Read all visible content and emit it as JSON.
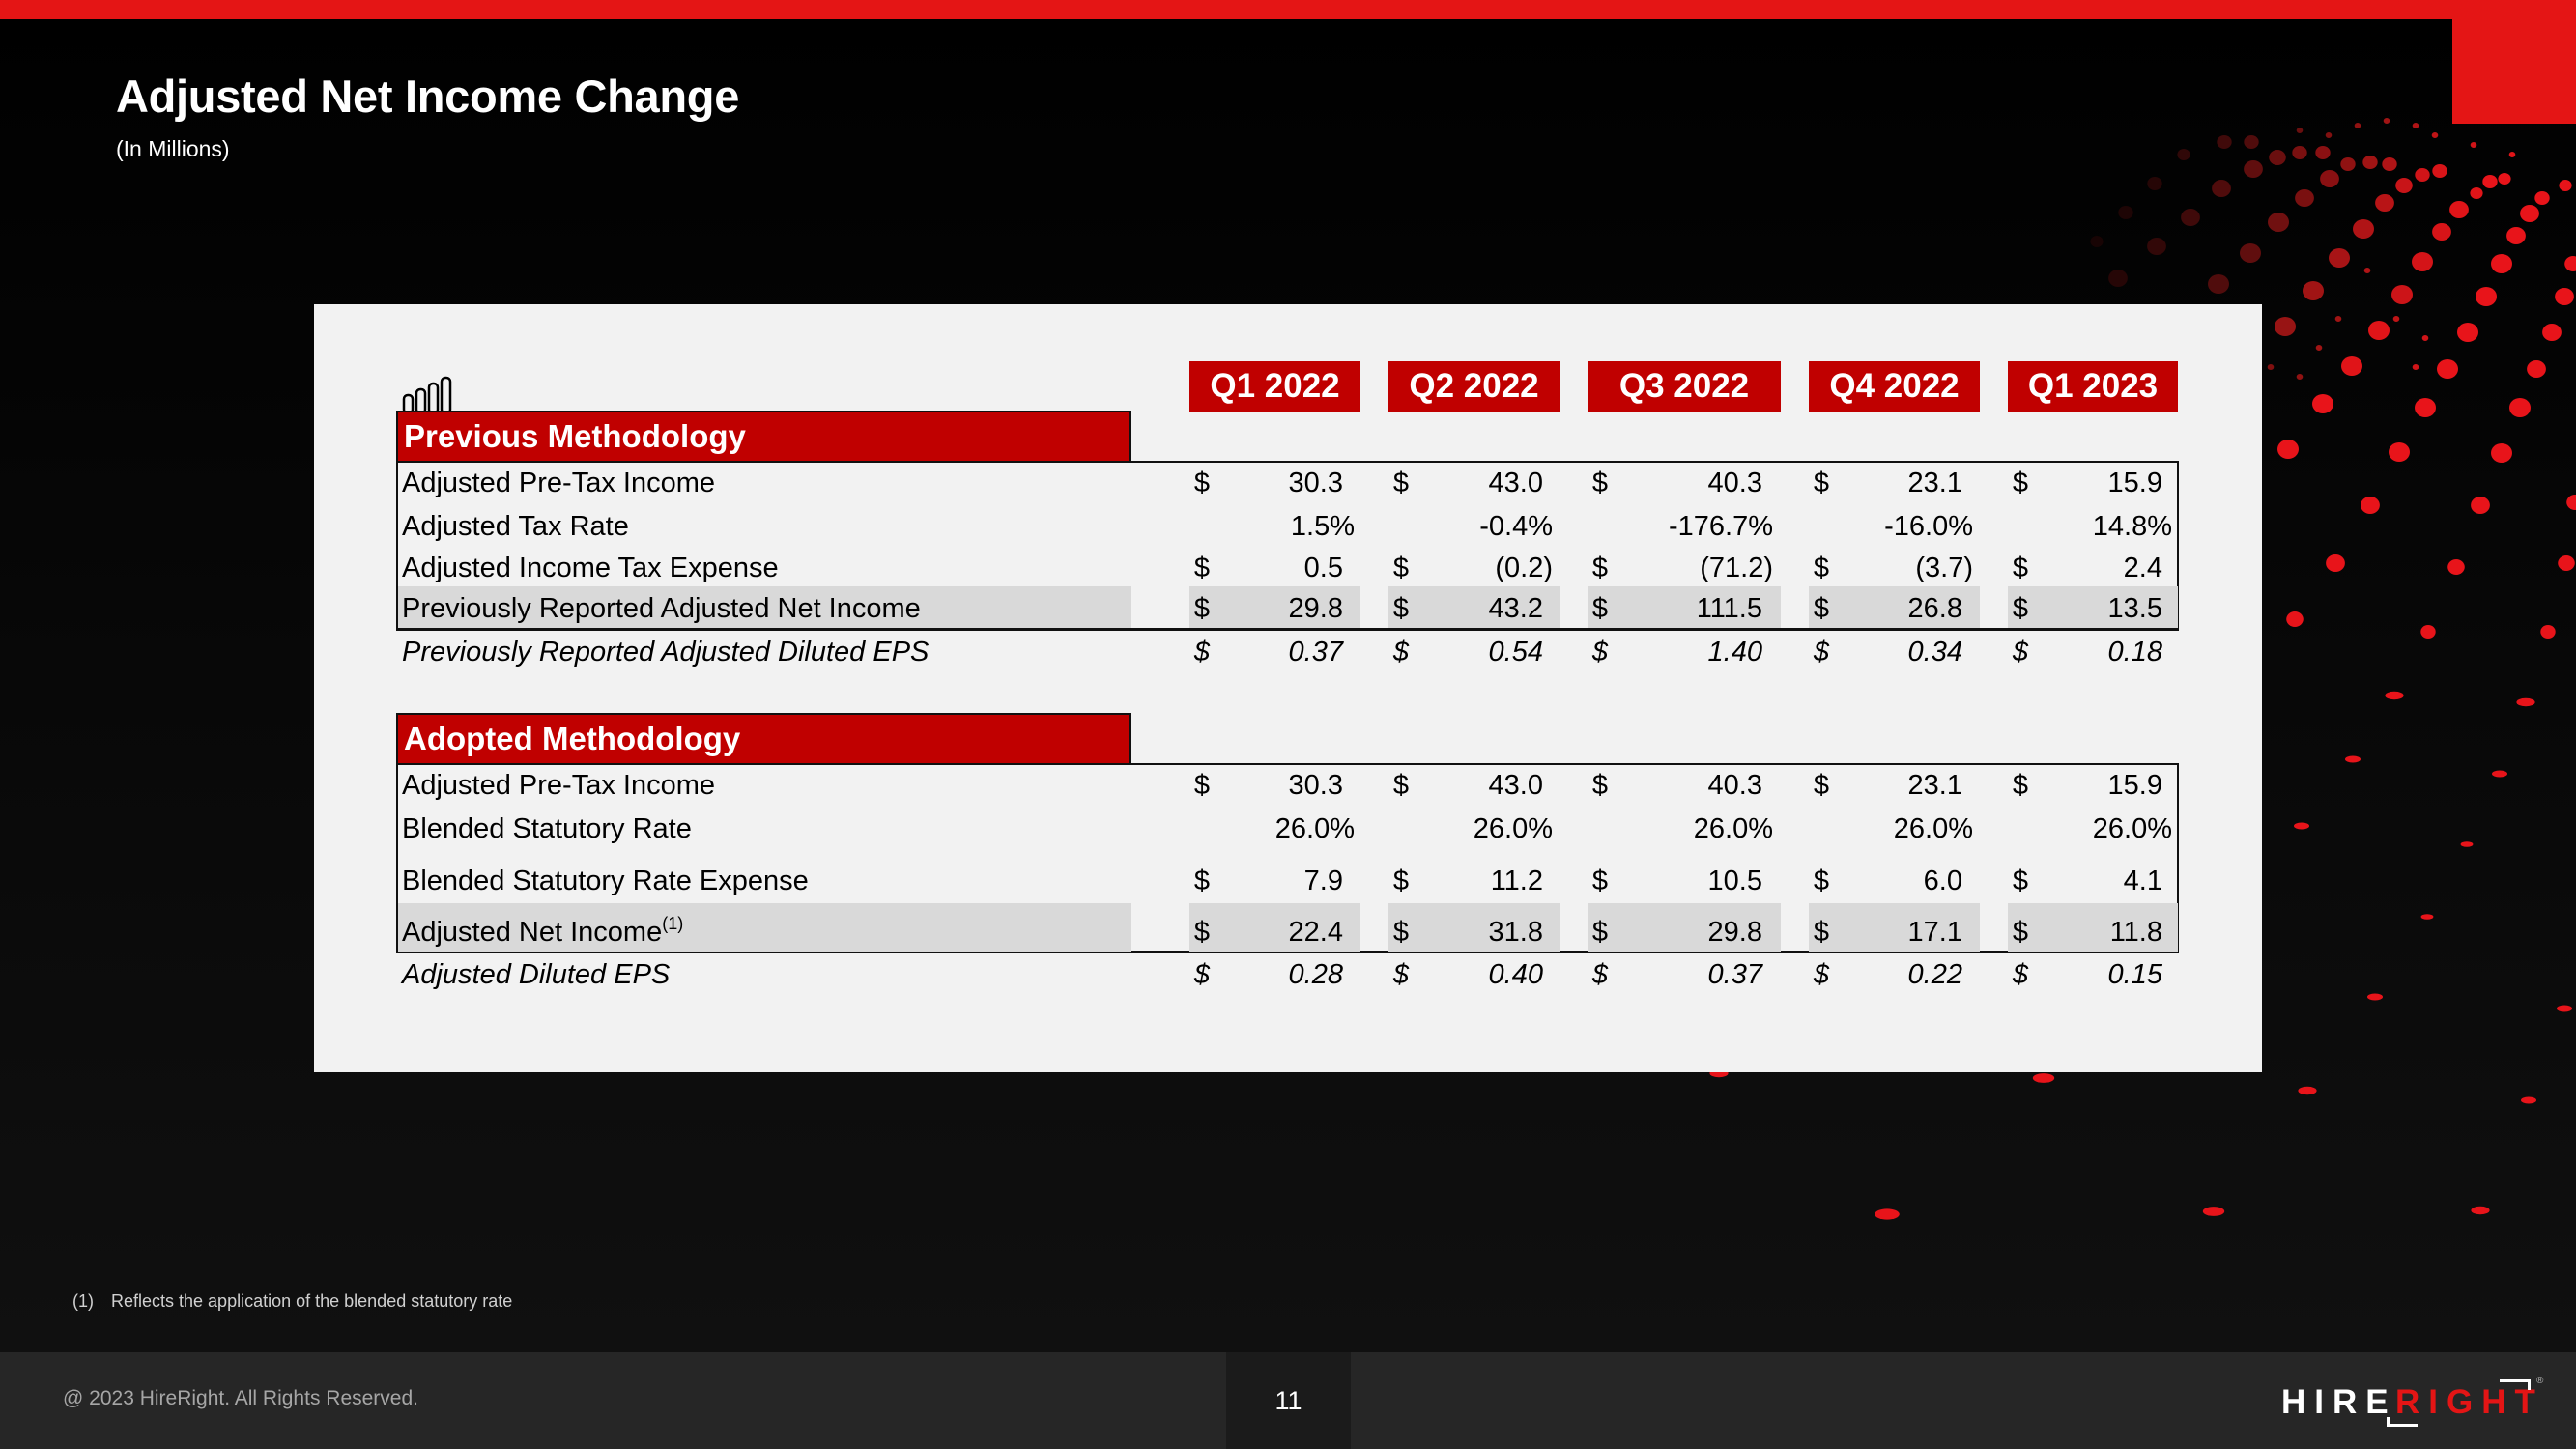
{
  "slide": {
    "title": "Adjusted Net Income Change",
    "subtitle": "(In Millions)",
    "page_number": "11",
    "copyright": "@ 2023  HireRight. All Rights Reserved.",
    "footnote": {
      "marker": "(1)",
      "text": "Reflects the application of the blended statutory rate"
    },
    "logo": {
      "part1": "HIRE",
      "part2": "RIGHT",
      "registered": "®"
    },
    "colors": {
      "brand_red": "#e41515",
      "header_red": "#c00000",
      "highlight_gray": "#d9d9d9"
    }
  },
  "table": {
    "icon": "bar-chart-icon",
    "periods": [
      "Q1 2022",
      "Q2 2022",
      "Q3 2022",
      "Q4 2022",
      "Q1 2023"
    ],
    "sections": [
      {
        "title": "Previous Methodology",
        "rows": [
          {
            "label": "Adjusted Pre-Tax Income",
            "currency": true,
            "values": [
              "30.3",
              "43.0",
              "40.3",
              "23.1",
              "15.9"
            ]
          },
          {
            "label": "Adjusted Tax Rate",
            "currency": false,
            "values": [
              "1.5%",
              "-0.4%",
              "-176.7%",
              "-16.0%",
              "14.8%"
            ]
          },
          {
            "label": "Adjusted Income Tax Expense",
            "currency": true,
            "values": [
              "0.5",
              "(0.2)",
              "(71.2)",
              "(3.7)",
              "2.4"
            ]
          },
          {
            "label": "Previously Reported Adjusted Net Income",
            "currency": true,
            "highlight": true,
            "values": [
              "29.8",
              "43.2",
              "111.5",
              "26.8",
              "13.5"
            ]
          },
          {
            "label": "Previously Reported Adjusted Diluted EPS",
            "currency": true,
            "italic": true,
            "values": [
              "0.37",
              "0.54",
              "1.40",
              "0.34",
              "0.18"
            ]
          }
        ]
      },
      {
        "title": "Adopted Methodology",
        "rows": [
          {
            "label": "Adjusted Pre-Tax Income",
            "currency": true,
            "values": [
              "30.3",
              "43.0",
              "40.3",
              "23.1",
              "15.9"
            ]
          },
          {
            "label": "Blended Statutory Rate",
            "currency": false,
            "values": [
              "26.0%",
              "26.0%",
              "26.0%",
              "26.0%",
              "26.0%"
            ]
          },
          {
            "label": "Blended Statutory Rate Expense",
            "currency": true,
            "values": [
              "7.9",
              "11.2",
              "10.5",
              "6.0",
              "4.1"
            ]
          },
          {
            "label": "Adjusted Net Income",
            "superscript": "(1)",
            "currency": true,
            "highlight": true,
            "values": [
              "22.4",
              "31.8",
              "29.8",
              "17.1",
              "11.8"
            ]
          },
          {
            "label": "Adjusted Diluted EPS",
            "currency": true,
            "italic": true,
            "values": [
              "0.28",
              "0.40",
              "0.37",
              "0.22",
              "0.15"
            ]
          }
        ]
      }
    ],
    "currency_symbol": "$"
  }
}
